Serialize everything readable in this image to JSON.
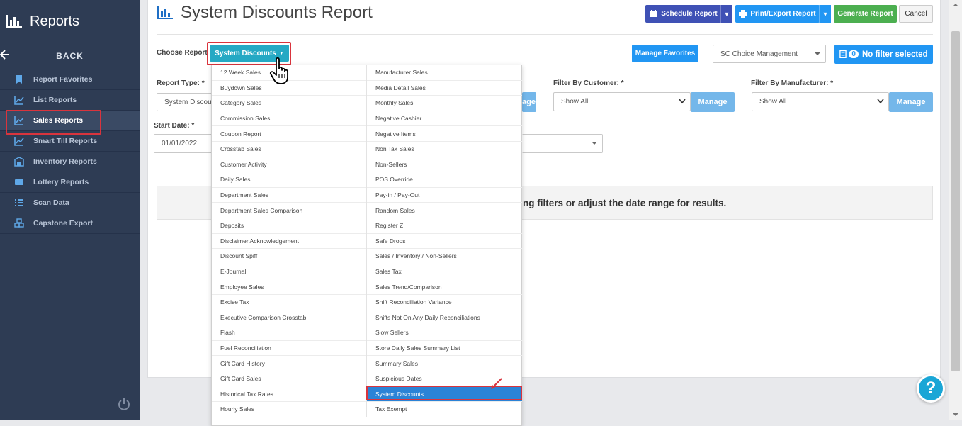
{
  "sidebar": {
    "title": "Reports",
    "back_label": "BACK",
    "items": [
      {
        "label": "Report Favorites",
        "icon": "bookmark-icon"
      },
      {
        "label": "List Reports",
        "icon": "line-chart-icon"
      },
      {
        "label": "Sales Reports",
        "icon": "line-chart-icon",
        "active": true
      },
      {
        "label": "Smart Till Reports",
        "icon": "line-chart-icon"
      },
      {
        "label": "Inventory Reports",
        "icon": "warehouse-icon"
      },
      {
        "label": "Lottery Reports",
        "icon": "ticket-icon"
      },
      {
        "label": "Scan Data",
        "icon": "list-icon"
      },
      {
        "label": "Capstone Export",
        "icon": "cubes-icon"
      }
    ]
  },
  "header": {
    "title": "System Discounts Report",
    "schedule_label": "Schedule Report",
    "print_label": "Print/Export Report",
    "generate_label": "Generate Report",
    "cancel_label": "Cancel"
  },
  "toolbar": {
    "choose_label": "Choose Report",
    "choose_value": "System Discounts",
    "favorites_label": "Manage Favorites",
    "store_value": "SC Choice Management",
    "filter_count": "0",
    "filter_label": "No filter selected"
  },
  "filters": {
    "report_type_label": "Report Type: *",
    "report_type_value": "System Discou",
    "customer_label": "Filter By Customer: *",
    "customer_value": "Show All",
    "manufacturer_label": "Filter By Manufacturer: *",
    "manufacturer_value": "Show All",
    "manage_label": "Manage",
    "manage_partial": "age",
    "start_date_label": "Start Date: *",
    "start_date_value": "01/01/2022"
  },
  "message": "ng filters or adjust the date range for results.",
  "dropdown": {
    "left": [
      "12 Week Sales",
      "Buydown Sales",
      "Category Sales",
      "Commission Sales",
      "Coupon Report",
      "Crosstab Sales",
      "Customer Activity",
      "Daily Sales",
      "Department Sales",
      "Department Sales Comparison",
      "Deposits",
      "Disclaimer Acknowledgement",
      "Discount Spiff",
      "E-Journal",
      "Employee Sales",
      "Excise Tax",
      "Executive Comparison Crosstab",
      "Flash",
      "Fuel Reconciliation",
      "Gift Card History",
      "Gift Card Sales",
      "Historical Tax Rates",
      "Hourly Sales"
    ],
    "right": [
      "Manufacturer Sales",
      "Media Detail Sales",
      "Monthly Sales",
      "Negative Cashier",
      "Negative Items",
      "Non Tax Sales",
      "Non-Sellers",
      "POS Override",
      "Pay-in / Pay-Out",
      "Random Sales",
      "Register Z",
      "Safe Drops",
      "Sales / Inventory / Non-Sellers",
      "Sales Tax",
      "Sales Trend/Comparison",
      "Shift Reconciliation Variance",
      "Shifts Not On Any Daily Reconciliations",
      "Slow Sellers",
      "Store Daily Sales Summary List",
      "Summary Sales",
      "Suspicious Dates",
      "System Discounts",
      "Tax Exempt"
    ],
    "selected": "System Discounts"
  },
  "help_label": "?",
  "colors": {
    "sidebar_bg": "#2e3c54",
    "schedule_btn": "#3f51b5",
    "print_btn": "#2196f3",
    "generate_btn": "#4caf50",
    "choose_btn": "#25a9c4",
    "highlight": "#d9343d"
  }
}
